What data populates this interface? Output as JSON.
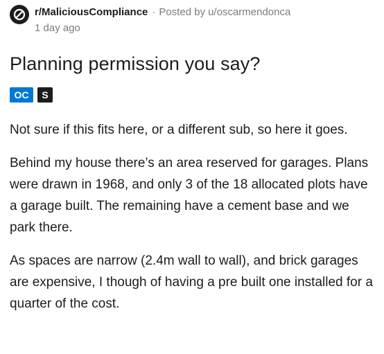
{
  "post": {
    "subreddit": "r/MaliciousCompliance",
    "separator": "·",
    "posted_by_prefix": "Posted by",
    "author": "u/oscarmendonca",
    "time": "1 day ago",
    "title": "Planning permission you say?",
    "flairs": [
      {
        "label": "OC",
        "color": "#0079d3"
      },
      {
        "label": "S",
        "color": "#1c1c1c"
      }
    ],
    "paragraphs": [
      "Not sure if this fits here, or a different sub, so here it goes.",
      "Behind my house there’s an area reserved for garages. Plans were drawn in 1968, and only 3 of the 18 allocated plots have a garage built. The remaining have a cement base and we park there.",
      "As spaces are narrow (2.4m wall to wall), and brick garages are expensive, I though of having a pre built one installed for a quarter of the cost."
    ]
  },
  "icons": {
    "subreddit_icon": "subreddit-no-entry-icon"
  },
  "colors": {
    "text": "#1c1c1c",
    "muted": "#7c7c7c",
    "oc_flair": "#0079d3",
    "s_flair": "#1c1c1c"
  }
}
